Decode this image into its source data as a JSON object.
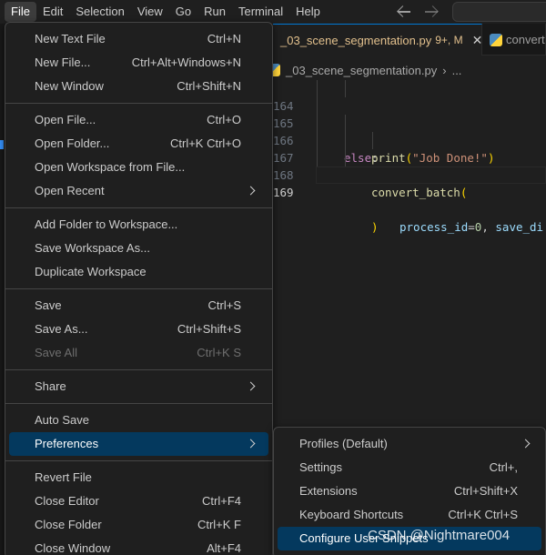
{
  "menubar": {
    "items": [
      {
        "label": "File",
        "active": true
      },
      {
        "label": "Edit"
      },
      {
        "label": "Selection"
      },
      {
        "label": "View"
      },
      {
        "label": "Go"
      },
      {
        "label": "Run"
      },
      {
        "label": "Terminal"
      },
      {
        "label": "Help"
      }
    ]
  },
  "editor": {
    "tabs": [
      {
        "label": "_03_scene_segmentation.py",
        "status": "9+, M",
        "active": true
      },
      {
        "label": "convert",
        "active": false
      }
    ],
    "breadcrumb": {
      "file": "_03_scene_segmentation.py",
      "separator": "›",
      "more": "..."
    },
    "lines": [
      {
        "number": "164"
      },
      {
        "number": "165"
      },
      {
        "number": "166"
      },
      {
        "number": "167"
      },
      {
        "number": "168"
      },
      {
        "number": "169"
      }
    ],
    "code": {
      "print_fn": "print",
      "print_str": "\"Job Done!\"",
      "else_kw": "else",
      "colon": ":",
      "convert_fn": "convert_batch",
      "param1": "process_id",
      "eq": "=",
      "val1": "0",
      "comma": ", ",
      "param2": "save_di",
      "open_paren": "(",
      "close_paren": ")"
    }
  },
  "file_menu": {
    "groups": [
      [
        {
          "label": "New Text File",
          "shortcut": "Ctrl+N"
        },
        {
          "label": "New File...",
          "shortcut": "Ctrl+Alt+Windows+N"
        },
        {
          "label": "New Window",
          "shortcut": "Ctrl+Shift+N"
        }
      ],
      [
        {
          "label": "Open File...",
          "shortcut": "Ctrl+O"
        },
        {
          "label": "Open Folder...",
          "shortcut": "Ctrl+K Ctrl+O"
        },
        {
          "label": "Open Workspace from File...",
          "shortcut": ""
        },
        {
          "label": "Open Recent",
          "shortcut": "",
          "submenu": true
        }
      ],
      [
        {
          "label": "Add Folder to Workspace...",
          "shortcut": ""
        },
        {
          "label": "Save Workspace As...",
          "shortcut": ""
        },
        {
          "label": "Duplicate Workspace",
          "shortcut": ""
        }
      ],
      [
        {
          "label": "Save",
          "shortcut": "Ctrl+S"
        },
        {
          "label": "Save As...",
          "shortcut": "Ctrl+Shift+S"
        },
        {
          "label": "Save All",
          "shortcut": "Ctrl+K S",
          "disabled": true
        }
      ],
      [
        {
          "label": "Share",
          "shortcut": "",
          "submenu": true
        }
      ],
      [
        {
          "label": "Auto Save",
          "shortcut": ""
        },
        {
          "label": "Preferences",
          "shortcut": "",
          "submenu": true,
          "selected": true
        }
      ],
      [
        {
          "label": "Revert File",
          "shortcut": ""
        },
        {
          "label": "Close Editor",
          "shortcut": "Ctrl+F4"
        },
        {
          "label": "Close Folder",
          "shortcut": "Ctrl+K F"
        },
        {
          "label": "Close Window",
          "shortcut": "Alt+F4"
        }
      ]
    ]
  },
  "preferences_menu": {
    "items": [
      {
        "label": "Profiles (Default)",
        "shortcut": "",
        "submenu": true
      },
      {
        "label": "Settings",
        "shortcut": "Ctrl+,"
      },
      {
        "label": "Extensions",
        "shortcut": "Ctrl+Shift+X"
      },
      {
        "label": "Keyboard Shortcuts",
        "shortcut": "Ctrl+K Ctrl+S"
      },
      {
        "label": "Configure User Snippets",
        "shortcut": "",
        "selected": true
      }
    ]
  },
  "watermark": "CSDN @Nightmare004",
  "colors": {
    "background": "#1f1f1f",
    "menu_selected": "#04395e",
    "accent": "#0078d4",
    "modified": "#e2c08d"
  }
}
